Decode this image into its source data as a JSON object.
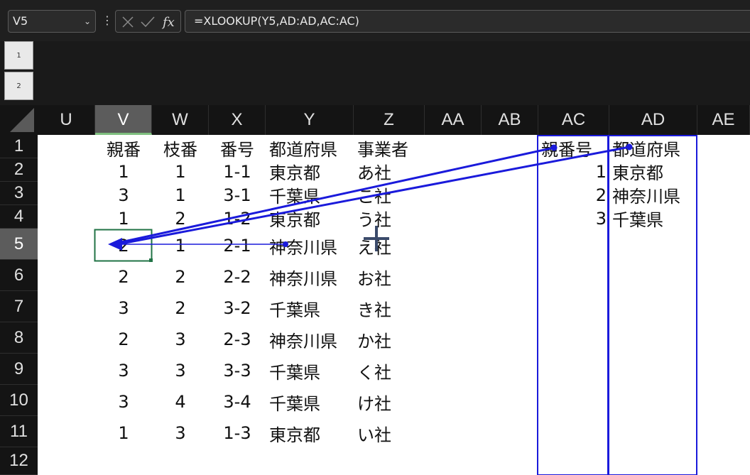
{
  "formula_bar": {
    "name_box": "V5",
    "formula": "=XLOOKUP(Y5,AD:AD,AC:AC)"
  },
  "outline_levels": [
    "1",
    "2"
  ],
  "columns": [
    "U",
    "V",
    "W",
    "X",
    "Y",
    "Z",
    "AA",
    "AB",
    "AC",
    "AD",
    "AE"
  ],
  "selected_column": "V",
  "rows": [
    "1",
    "2",
    "3",
    "4",
    "5",
    "6",
    "7",
    "8",
    "9",
    "10",
    "11",
    "12"
  ],
  "selected_row": "5",
  "table_main": {
    "headers": [
      "親番",
      "枝番",
      "番号",
      "都道府県",
      "事業者"
    ],
    "rows": [
      [
        "1",
        "1",
        "1-1",
        "東京都",
        "あ社"
      ],
      [
        "3",
        "1",
        "3-1",
        "千葉県",
        "こ社"
      ],
      [
        "1",
        "2",
        "1-2",
        "東京都",
        "う社"
      ],
      [
        "2",
        "1",
        "2-1",
        "神奈川県",
        "え社"
      ],
      [
        "2",
        "2",
        "2-2",
        "神奈川県",
        "お社"
      ],
      [
        "3",
        "2",
        "3-2",
        "千葉県",
        "き社"
      ],
      [
        "2",
        "3",
        "2-3",
        "神奈川県",
        "か社"
      ],
      [
        "3",
        "3",
        "3-3",
        "千葉県",
        "く社"
      ],
      [
        "3",
        "4",
        "3-4",
        "千葉県",
        "け社"
      ],
      [
        "1",
        "3",
        "1-3",
        "東京都",
        "い社"
      ]
    ]
  },
  "table_lookup": {
    "headers": [
      "親番号",
      "都道府県"
    ],
    "rows": [
      [
        "1",
        "東京都"
      ],
      [
        "2",
        "神奈川県"
      ],
      [
        "3",
        "千葉県"
      ]
    ]
  },
  "colors": {
    "trace_arrow": "#1a1adb",
    "selection": "#217346",
    "header_selected": "#5c5c5c"
  },
  "icons": [
    "cancel-icon",
    "enter-icon",
    "fx-icon",
    "chevron-down-icon",
    "move-cursor-icon"
  ]
}
